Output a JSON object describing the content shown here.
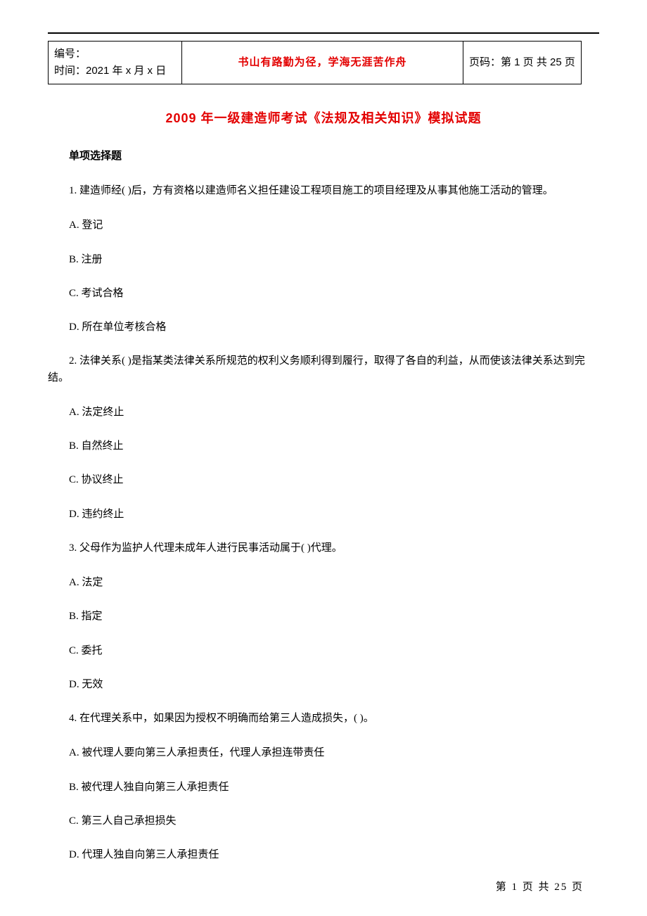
{
  "header": {
    "left_line1": "编号：",
    "left_line2": "时间：2021 年 x 月 x 日",
    "motto": "书山有路勤为径，学海无涯苦作舟",
    "page_label": "页码：第 1 页  共 25 页"
  },
  "title": "2009 年一级建造师考试《法规及相关知识》模拟试题",
  "section_heading": "单项选择题",
  "questions": [
    {
      "stem": "1. 建造师经( )后，方有资格以建造师名义担任建设工程项目施工的项目经理及从事其他施工活动的管理。",
      "options": [
        "A. 登记",
        "B. 注册",
        "C. 考试合格",
        "D. 所在单位考核合格"
      ]
    },
    {
      "stem": "2. 法律关系( )是指某类法律关系所规范的权利义务顺利得到履行，取得了各自的利益，从而使该法律关系达到完结。",
      "options": [
        "A. 法定终止",
        "B. 自然终止",
        "C. 协议终止",
        "D. 违约终止"
      ]
    },
    {
      "stem": "3. 父母作为监护人代理未成年人进行民事活动属于( )代理。",
      "options": [
        "A. 法定",
        "B. 指定",
        "C. 委托",
        "D. 无效"
      ]
    },
    {
      "stem": "4. 在代理关系中，如果因为授权不明确而给第三人造成损失，( )。",
      "options": [
        "A. 被代理人要向第三人承担责任，代理人承担连带责任",
        "B. 被代理人独自向第三人承担责任",
        "C. 第三人自己承担损失",
        "D. 代理人独自向第三人承担责任"
      ]
    }
  ],
  "footer": "第 1 页 共 25 页"
}
